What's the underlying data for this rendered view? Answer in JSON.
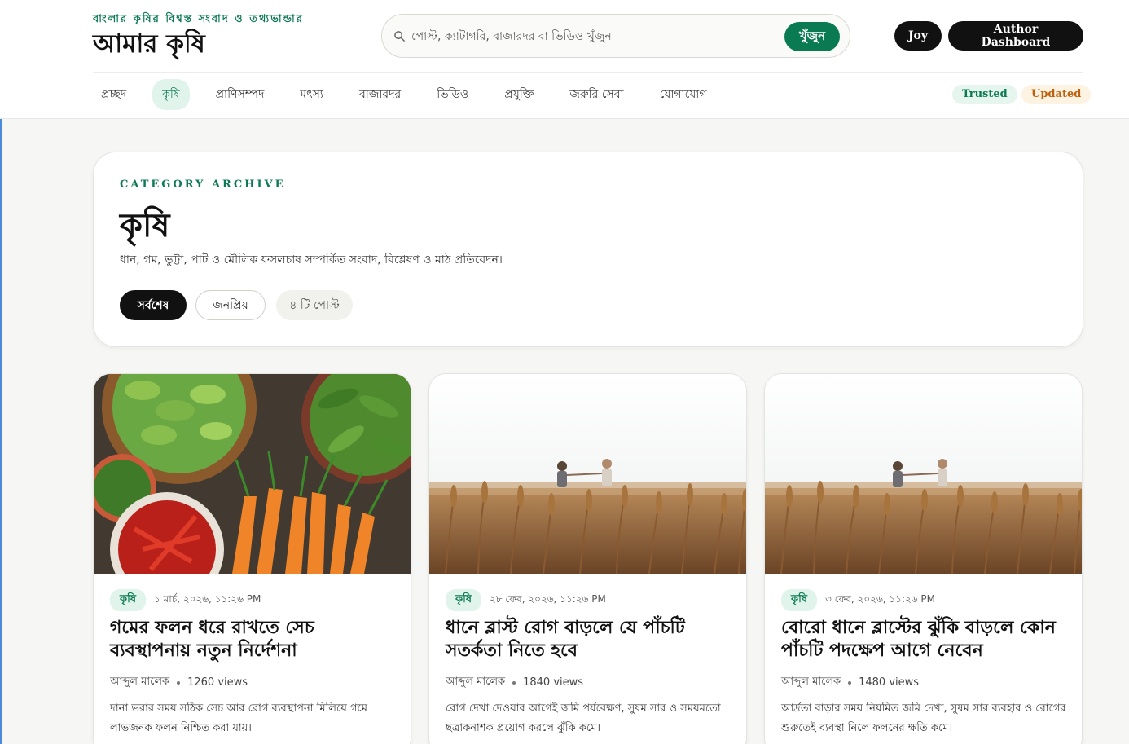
{
  "brand": {
    "tagline": "বাংলার কৃষির বিশ্বস্ত সংবাদ ও তথ্যভান্ডার",
    "name": "আমার কৃষি"
  },
  "search": {
    "placeholder": "পোস্ট, ক্যাটাগরি, বাজারদর বা ভিডিও খুঁজুন",
    "button_label": "খুঁজুন"
  },
  "user": {
    "name": "Joy",
    "dashboard_label": "Author Dashboard"
  },
  "nav": {
    "items": [
      {
        "label": "প্রচ্ছদ"
      },
      {
        "label": "কৃষি"
      },
      {
        "label": "প্রাণিসম্পদ"
      },
      {
        "label": "মৎস্য"
      },
      {
        "label": "বাজারদর"
      },
      {
        "label": "ভিডিও"
      },
      {
        "label": "প্রযুক্তি"
      },
      {
        "label": "জরুরি সেবা"
      },
      {
        "label": "যোগাযোগ"
      }
    ],
    "active_index": 1,
    "badges": {
      "trusted": "Trusted",
      "updated": "Updated"
    }
  },
  "archive": {
    "kicker": "CATEGORY ARCHIVE",
    "title": "কৃষি",
    "description": "ধান, গম, ভুট্টা, পাট ও মৌলিক ফসলচাষ সম্পর্কিত সংবাদ, বিশ্লেষণ ও মাঠ প্রতিবেদন।",
    "filters": {
      "latest": "সর্বশেষ",
      "popular": "জনপ্রিয়"
    },
    "post_count": "৪ টি পোস্ট"
  },
  "posts": [
    {
      "category": "কৃষি",
      "date": "১ মার্চ, ২০২৬, ১১:২৬ PM",
      "title": "গমের ফলন ধরে রাখতে সেচ ব্যবস্থাপনায় নতুন নির্দেশনা",
      "author": "আব্দুল মালেক",
      "views": "1260 views",
      "excerpt": "দানা ভরার সময় সঠিক সেচ আর রোগ ব্যবস্থাপনা মিলিয়ে গমে লাভজনক ফলন নিশ্চিত করা যায়।",
      "image": "vegetables-photo"
    },
    {
      "category": "কৃষি",
      "date": "২৮ ফেব, ২০২৬, ১১:২৬ PM",
      "title": "ধানে ব্লাস্ট রোগ বাড়লে যে পাঁচটি সতর্কতা নিতে হবে",
      "author": "আব্দুল মালেক",
      "views": "1840 views",
      "excerpt": "রোগ দেখা দেওয়ার আগেই জমি পর্যবেক্ষণ, সুষম সার ও সময়মতো ছত্রাকনাশক প্রয়োগ করলে ঝুঁকি কমে।",
      "image": "wheat-field-photo"
    },
    {
      "category": "কৃষি",
      "date": "৩ ফেব, ২০২৬, ১১:২৬ PM",
      "title": "বোরো ধানে ব্লাস্টের ঝুঁকি বাড়লে কোন পাঁচটি পদক্ষেপ আগে নেবেন",
      "author": "আব্দুল মালেক",
      "views": "1480 views",
      "excerpt": "আর্দ্রতা বাড়ার সময় নিয়মিত জমি দেখা, সুষম সার ব্যবহার ও রোগের শুরুতেই ব্যবস্থা নিলে ফলনের ক্ষতি কমে।",
      "image": "wheat-field-photo"
    }
  ],
  "colors": {
    "accent": "#0a7a52",
    "accent_soft": "#e1f4ec",
    "dark": "#111111",
    "updated": "#c0600e"
  }
}
